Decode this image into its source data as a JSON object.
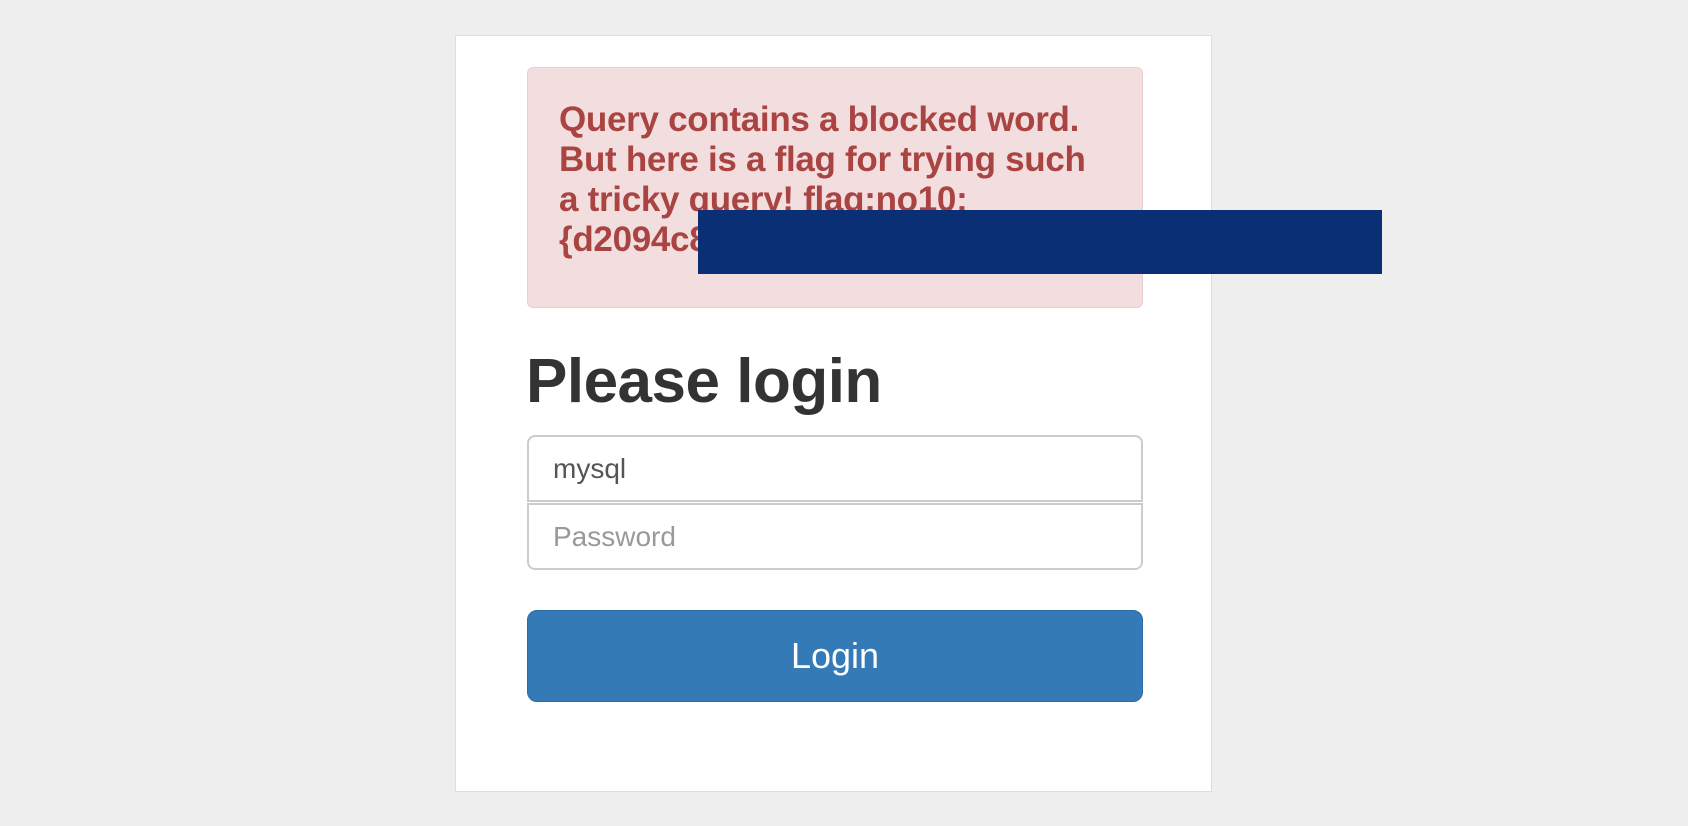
{
  "alert": {
    "lines": [
      "Query contains a blocked word.",
      "But here is a flag for trying such",
      "a tricky query! flag:no10:",
      "{d2094c8"
    ]
  },
  "login": {
    "heading": "Please login",
    "username_value": "mysql",
    "password_placeholder": "Password",
    "button_label": "Login"
  },
  "colors": {
    "page_background": "#eeeeee",
    "alert_background": "#f2dede",
    "alert_text": "#a94442",
    "button_primary": "#337ab7",
    "redaction_box": "#0a2f75"
  }
}
